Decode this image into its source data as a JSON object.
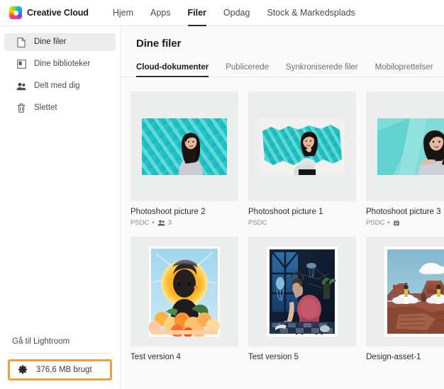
{
  "topbar": {
    "logo_icon": "creative-cloud-logo",
    "brand": "Creative Cloud",
    "nav": [
      {
        "label": "Hjem",
        "active": false
      },
      {
        "label": "Apps",
        "active": false
      },
      {
        "label": "Filer",
        "active": true
      },
      {
        "label": "Opdag",
        "active": false
      },
      {
        "label": "Stock & Markedsplads",
        "active": false
      }
    ]
  },
  "sidebar": {
    "items": [
      {
        "label": "Dine filer",
        "icon": "file-icon",
        "selected": true
      },
      {
        "label": "Dine biblioteker",
        "icon": "library-icon",
        "selected": false
      },
      {
        "label": "Delt med dig",
        "icon": "people-icon",
        "selected": false
      },
      {
        "label": "Slettet",
        "icon": "trash-icon",
        "selected": false
      }
    ],
    "lightroom_link": "Gå til Lightroom",
    "storage": {
      "icon": "gear-icon",
      "label": "376,6 MB brugt",
      "highlight_color": "#e8a33d"
    }
  },
  "main": {
    "title": "Dine filer",
    "tabs": [
      {
        "label": "Cloud-dokumenter",
        "active": true
      },
      {
        "label": "Publicerede",
        "active": false
      },
      {
        "label": "Synkroniserede filer",
        "active": false
      },
      {
        "label": "Mobiloprettelser",
        "active": false
      }
    ],
    "files": [
      {
        "title": "Photoshoot picture 2",
        "type": "PSDC",
        "shared_icon": "people-icon",
        "shared_count": "3",
        "published_icon": "",
        "thumb": "portrait-teal-stripes"
      },
      {
        "title": "Photoshoot picture 1",
        "type": "PSDC",
        "shared_icon": "",
        "shared_count": "",
        "published_icon": "",
        "thumb": "portrait-torn-teal"
      },
      {
        "title": "Photoshoot picture 3",
        "type": "PSDC",
        "shared_icon": "",
        "shared_count": "",
        "published_icon": "globe-icon",
        "thumb": "portrait-teal-wall"
      },
      {
        "title": "Test version 4",
        "type": "",
        "shared_icon": "",
        "shared_count": "",
        "published_icon": "",
        "thumb": "sun-flowers-portrait"
      },
      {
        "title": "Test version 5",
        "type": "",
        "shared_icon": "",
        "shared_count": "",
        "published_icon": "",
        "thumb": "underwater-room"
      },
      {
        "title": "Design-asset-1",
        "type": "",
        "shared_icon": "",
        "shared_count": "",
        "published_icon": "",
        "thumb": "desert-mesa"
      }
    ]
  }
}
